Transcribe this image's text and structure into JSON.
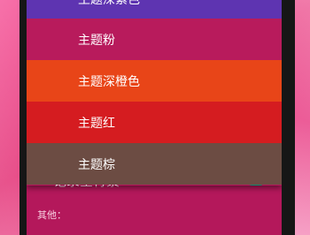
{
  "theme_menu": {
    "items": [
      {
        "label": "主题深紫色",
        "color": "#5e34b1"
      },
      {
        "label": "主题粉",
        "color": "#b81b5c"
      },
      {
        "label": "主题深橙色",
        "color": "#e84518"
      },
      {
        "label": "主题红",
        "color": "#d51c20"
      },
      {
        "label": "主题棕",
        "color": "#6c4c43"
      }
    ]
  },
  "settings": {
    "background_row_label": "记录全背景",
    "background_toggle_on": true,
    "other_section_header": "其他：",
    "partial_item_label": "​"
  },
  "colors": {
    "screen_background": "#b4185b",
    "toggle_color": "#0e8a6c"
  }
}
